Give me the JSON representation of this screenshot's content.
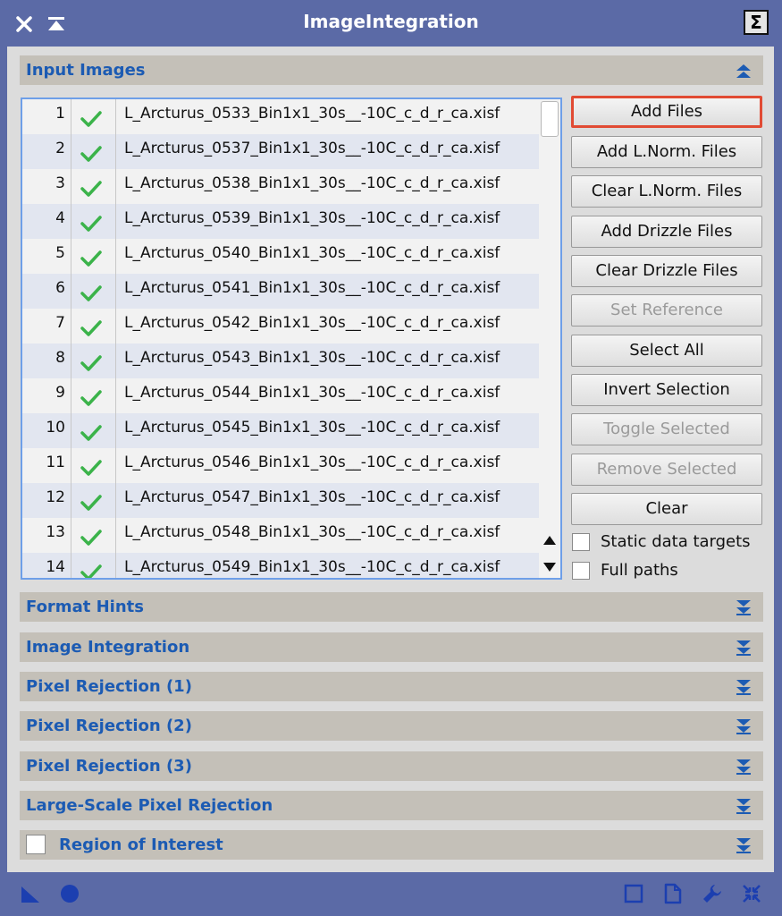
{
  "window": {
    "title": "ImageIntegration",
    "sigma_label": "Σ"
  },
  "sections": {
    "input_images": "Input Images",
    "format_hints": "Format Hints",
    "image_integration": "Image Integration",
    "pixel_rejection_1": "Pixel Rejection (1)",
    "pixel_rejection_2": "Pixel Rejection (2)",
    "pixel_rejection_3": "Pixel Rejection (3)",
    "large_scale": "Large-Scale Pixel Rejection",
    "roi": "Region of Interest"
  },
  "files": [
    {
      "index": "1",
      "name": "L_Arcturus_0533_Bin1x1_30s__-10C_c_d_r_ca.xisf",
      "enabled": true
    },
    {
      "index": "2",
      "name": "L_Arcturus_0537_Bin1x1_30s__-10C_c_d_r_ca.xisf",
      "enabled": true
    },
    {
      "index": "3",
      "name": "L_Arcturus_0538_Bin1x1_30s__-10C_c_d_r_ca.xisf",
      "enabled": true
    },
    {
      "index": "4",
      "name": "L_Arcturus_0539_Bin1x1_30s__-10C_c_d_r_ca.xisf",
      "enabled": true
    },
    {
      "index": "5",
      "name": "L_Arcturus_0540_Bin1x1_30s__-10C_c_d_r_ca.xisf",
      "enabled": true
    },
    {
      "index": "6",
      "name": "L_Arcturus_0541_Bin1x1_30s__-10C_c_d_r_ca.xisf",
      "enabled": true
    },
    {
      "index": "7",
      "name": "L_Arcturus_0542_Bin1x1_30s__-10C_c_d_r_ca.xisf",
      "enabled": true
    },
    {
      "index": "8",
      "name": "L_Arcturus_0543_Bin1x1_30s__-10C_c_d_r_ca.xisf",
      "enabled": true
    },
    {
      "index": "9",
      "name": "L_Arcturus_0544_Bin1x1_30s__-10C_c_d_r_ca.xisf",
      "enabled": true
    },
    {
      "index": "10",
      "name": "L_Arcturus_0545_Bin1x1_30s__-10C_c_d_r_ca.xisf",
      "enabled": true
    },
    {
      "index": "11",
      "name": "L_Arcturus_0546_Bin1x1_30s__-10C_c_d_r_ca.xisf",
      "enabled": true
    },
    {
      "index": "12",
      "name": "L_Arcturus_0547_Bin1x1_30s__-10C_c_d_r_ca.xisf",
      "enabled": true
    },
    {
      "index": "13",
      "name": "L_Arcturus_0548_Bin1x1_30s__-10C_c_d_r_ca.xisf",
      "enabled": true
    },
    {
      "index": "14",
      "name": "L_Arcturus_0549_Bin1x1_30s__-10C_c_d_r_ca.xisf",
      "enabled": true
    }
  ],
  "buttons": {
    "add_files": "Add Files",
    "add_lnorm": "Add L.Norm. Files",
    "clear_lnorm": "Clear L.Norm. Files",
    "add_drizzle": "Add Drizzle Files",
    "clear_drizzle": "Clear Drizzle Files",
    "set_reference": "Set Reference",
    "select_all": "Select All",
    "invert_selection": "Invert Selection",
    "toggle_selected": "Toggle Selected",
    "remove_selected": "Remove Selected",
    "clear": "Clear"
  },
  "options": {
    "static_data_targets": "Static data targets",
    "full_paths": "Full paths"
  },
  "colors": {
    "accent": "#1c5bb3",
    "titlebar": "#5b6aa6",
    "check": "#3bb34a",
    "focus_outline": "#e14b34"
  },
  "icons": {
    "title_left": [
      "close-icon",
      "shade-icon"
    ],
    "title_right": [
      "sigma-icon"
    ],
    "bottom_left": [
      "new-instance-icon",
      "apply-global-icon"
    ],
    "bottom_right": [
      "browse-docs-icon",
      "document-icon",
      "settings-wrench-icon",
      "reset-icon"
    ]
  }
}
